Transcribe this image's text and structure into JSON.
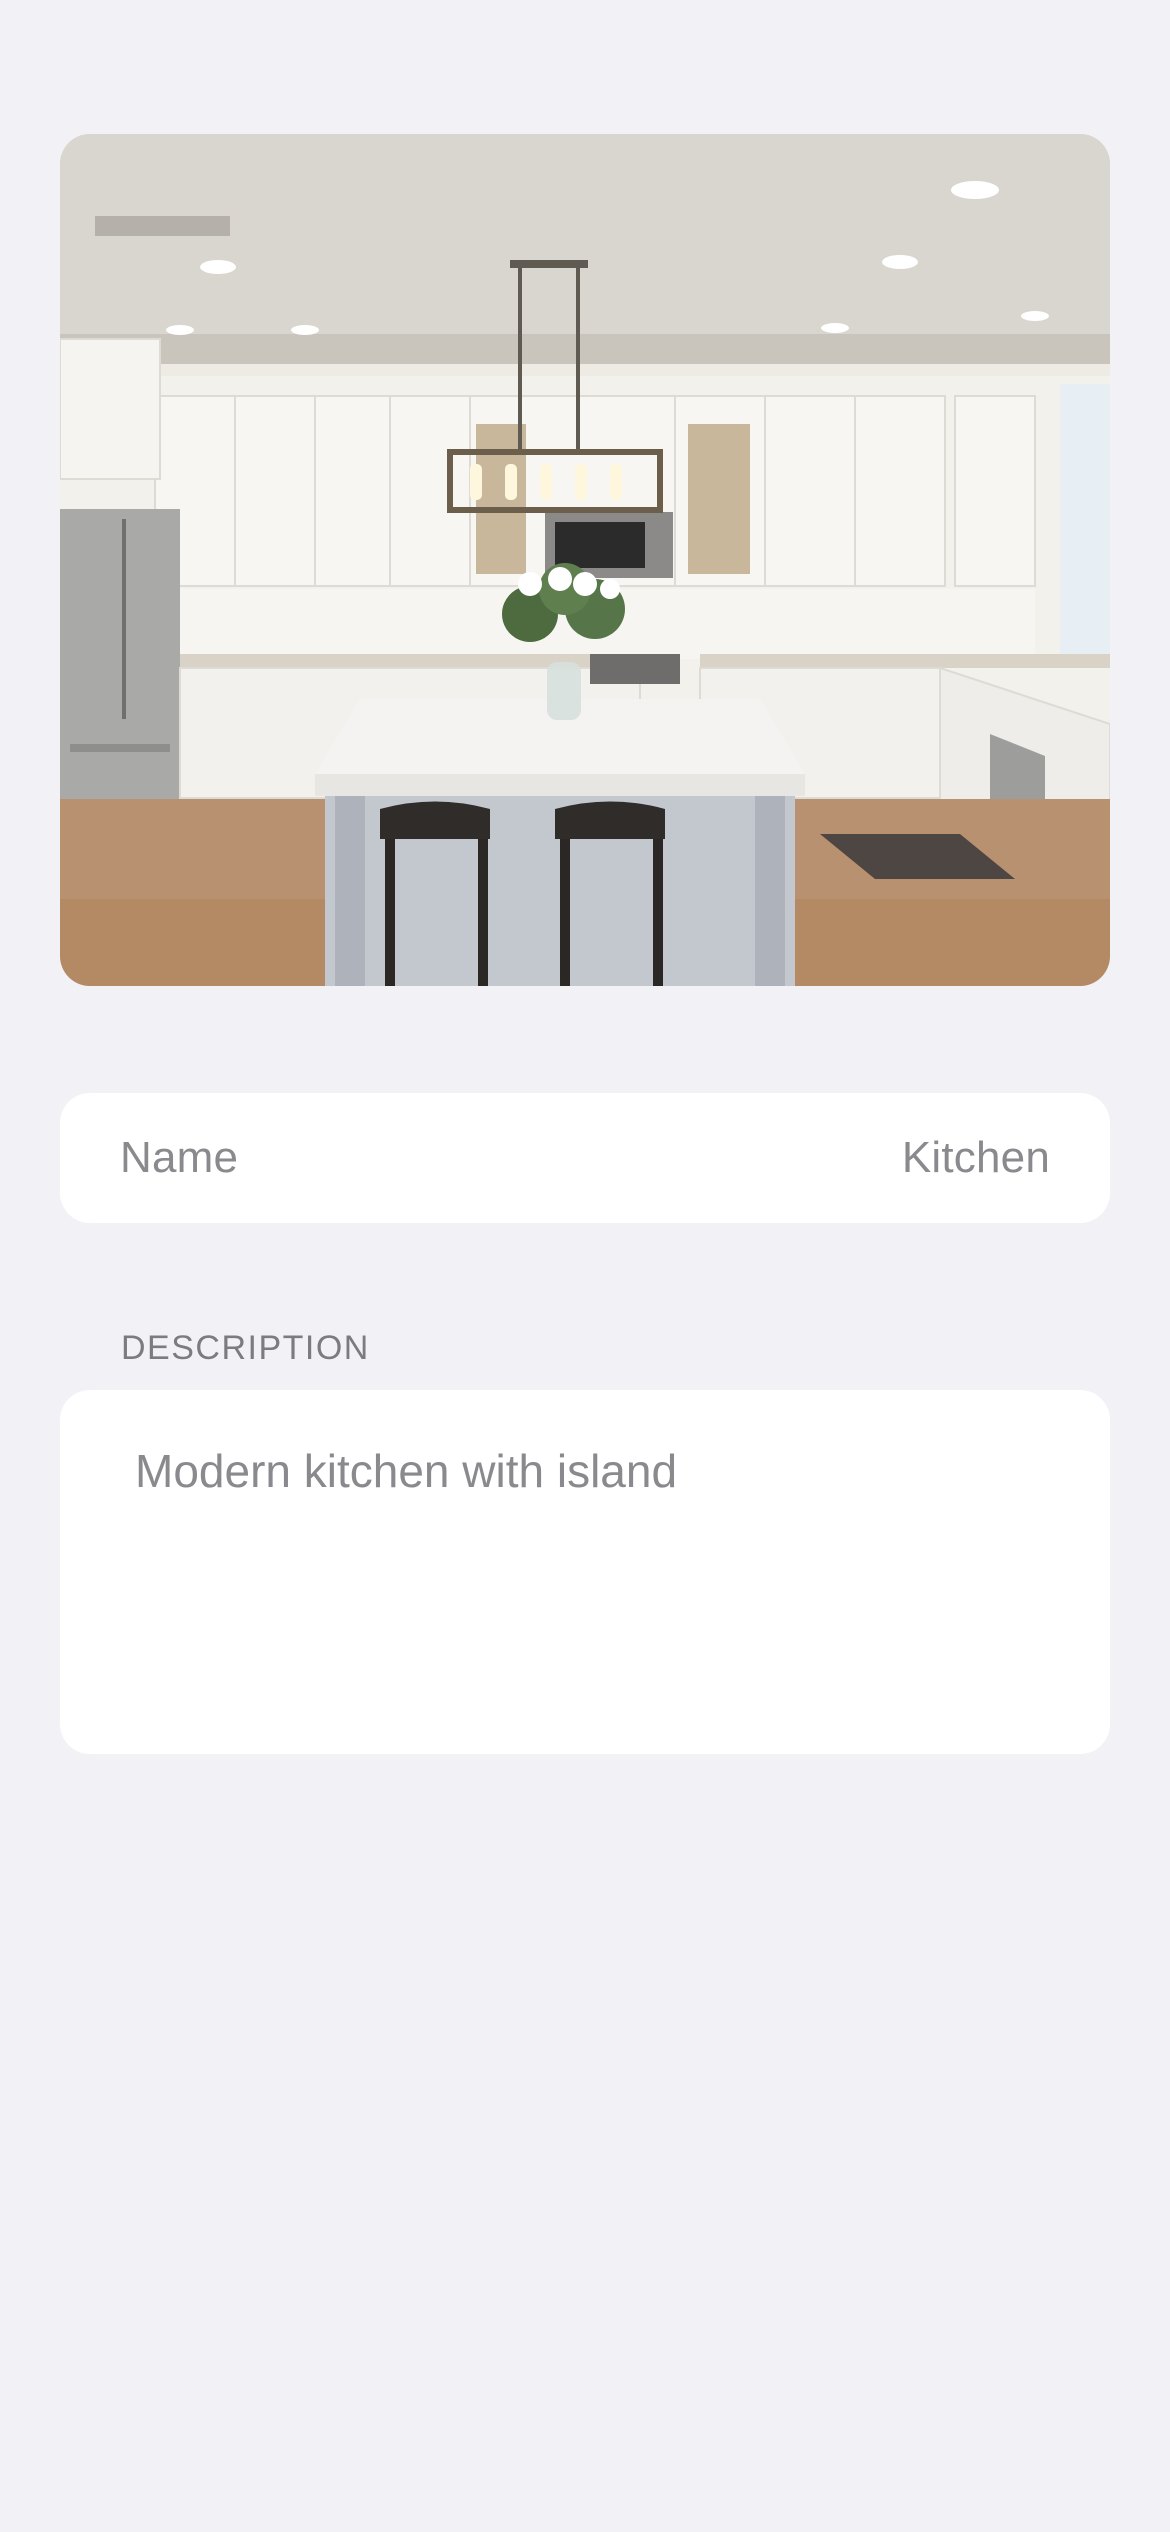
{
  "photo": {
    "icon": "kitchen-photo"
  },
  "name_field": {
    "label": "Name",
    "value": "Kitchen"
  },
  "description": {
    "header": "DESCRIPTION",
    "text": "Modern kitchen with island"
  },
  "colors": {
    "background": "#f2f1f6",
    "card": "#ffffff",
    "secondary_text": "#8a8a8e"
  }
}
